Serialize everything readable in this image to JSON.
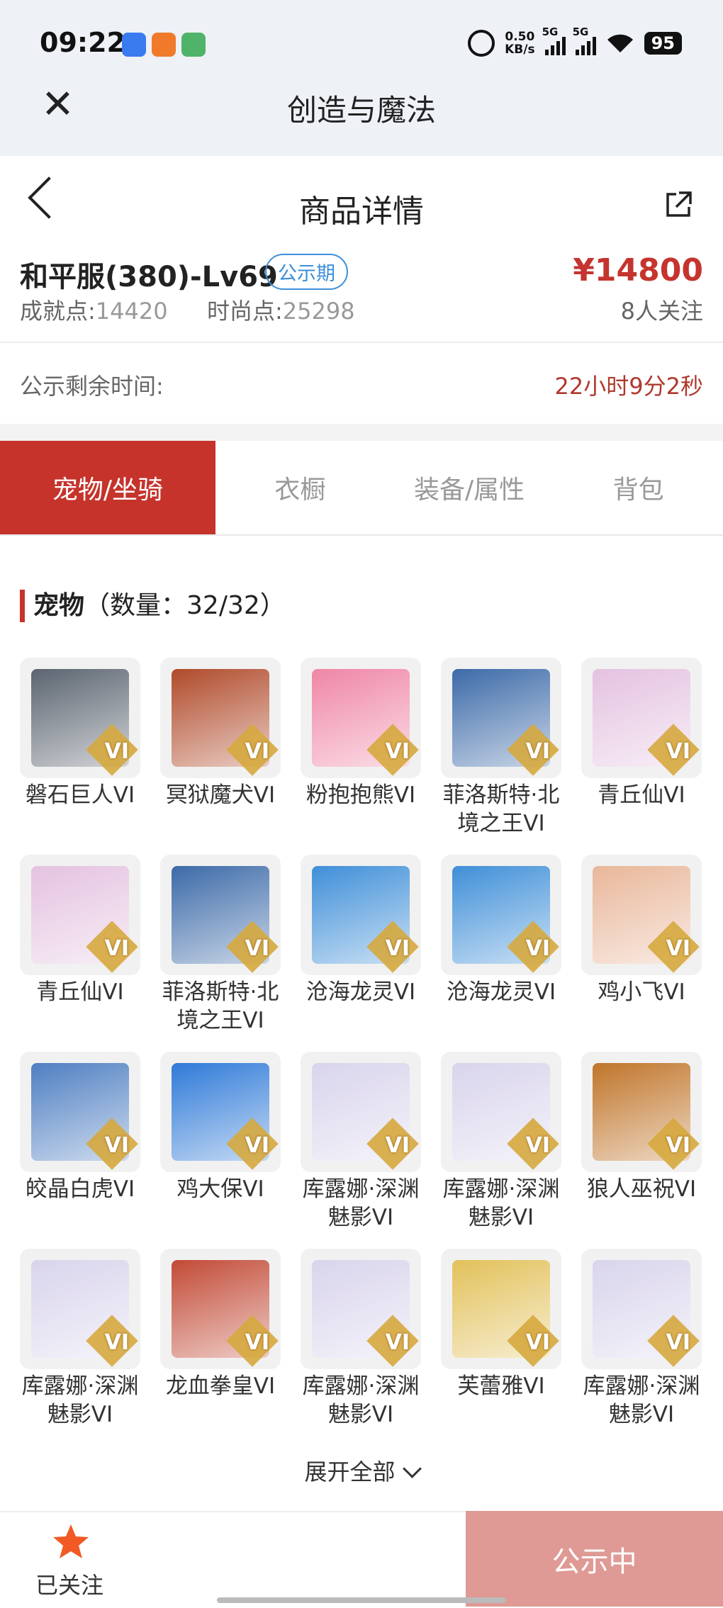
{
  "status": {
    "time": "09:22",
    "speed": "0.50",
    "speed_unit": "KB/s",
    "net1": "5G",
    "net2": "5G",
    "battery": "95"
  },
  "app_title": "创造与魔法",
  "nav": {
    "title": "商品详情"
  },
  "product": {
    "name": "和平服(380)-Lv69",
    "badge": "公示期",
    "price": "¥14800",
    "achievement_label": "成就点:",
    "achievement_value": "14420",
    "fashion_label": "时尚点:",
    "fashion_value": "25298",
    "followers": "8人关注"
  },
  "countdown": {
    "label": "公示剩余时间:",
    "value": "22小时9分2秒"
  },
  "tabs": [
    {
      "label": "宠物/坐骑"
    },
    {
      "label": "衣橱"
    },
    {
      "label": "装备/属性"
    },
    {
      "label": "背包"
    }
  ],
  "section": {
    "title": "宠物",
    "count": "（数量：32/32）"
  },
  "pets": [
    {
      "name": "磐石巨人VI",
      "color": "#5b6470",
      "badge": "VI"
    },
    {
      "name": "冥狱魔犬VI",
      "color": "#b04a2a",
      "badge": "VI"
    },
    {
      "name": "粉抱抱熊VI",
      "color": "#ef86a6",
      "badge": "VI"
    },
    {
      "name": "菲洛斯特·北境之王VI",
      "color": "#3c6aa8",
      "badge": "VI"
    },
    {
      "name": "青丘仙VI",
      "color": "#e4c2e0",
      "badge": "VI"
    },
    {
      "name": "青丘仙VI",
      "color": "#e4c2e0",
      "badge": "VI"
    },
    {
      "name": "菲洛斯特·北境之王VI",
      "color": "#3c6aa8",
      "badge": "VI"
    },
    {
      "name": "沧海龙灵VI",
      "color": "#3f8fd8",
      "badge": "VI"
    },
    {
      "name": "沧海龙灵VI",
      "color": "#3f8fd8",
      "badge": "VI"
    },
    {
      "name": "鸡小飞VI",
      "color": "#e9b79a",
      "badge": "VI"
    },
    {
      "name": "皎晶白虎VI",
      "color": "#4f7fc2",
      "badge": "VI"
    },
    {
      "name": "鸡大保VI",
      "color": "#2f7ad8",
      "badge": "VI"
    },
    {
      "name": "库露娜·深渊魅影VI",
      "color": "#d9d4ec",
      "badge": "VI"
    },
    {
      "name": "库露娜·深渊魅影VI",
      "color": "#d9d4ec",
      "badge": "VI"
    },
    {
      "name": "狼人巫祝VI",
      "color": "#c0752a",
      "badge": "VI"
    },
    {
      "name": "库露娜·深渊魅影VI",
      "color": "#d9d4ec",
      "badge": "VI"
    },
    {
      "name": "龙血拳皇VI",
      "color": "#c24a36",
      "badge": "VI"
    },
    {
      "name": "库露娜·深渊魅影VI",
      "color": "#d9d4ec",
      "badge": "VI"
    },
    {
      "name": "芙蕾雅VI",
      "color": "#e2c15a",
      "badge": "VI"
    },
    {
      "name": "库露娜·深渊魅影VI",
      "color": "#d9d4ec",
      "badge": "VI"
    }
  ],
  "expand_label": "展开全部",
  "bottom": {
    "followed_label": "已关注",
    "action_label": "公示中"
  },
  "colors": {
    "accent": "#c5332b",
    "price": "#c5342e",
    "badge": "#3d8fd8",
    "action": "#df9a95"
  }
}
